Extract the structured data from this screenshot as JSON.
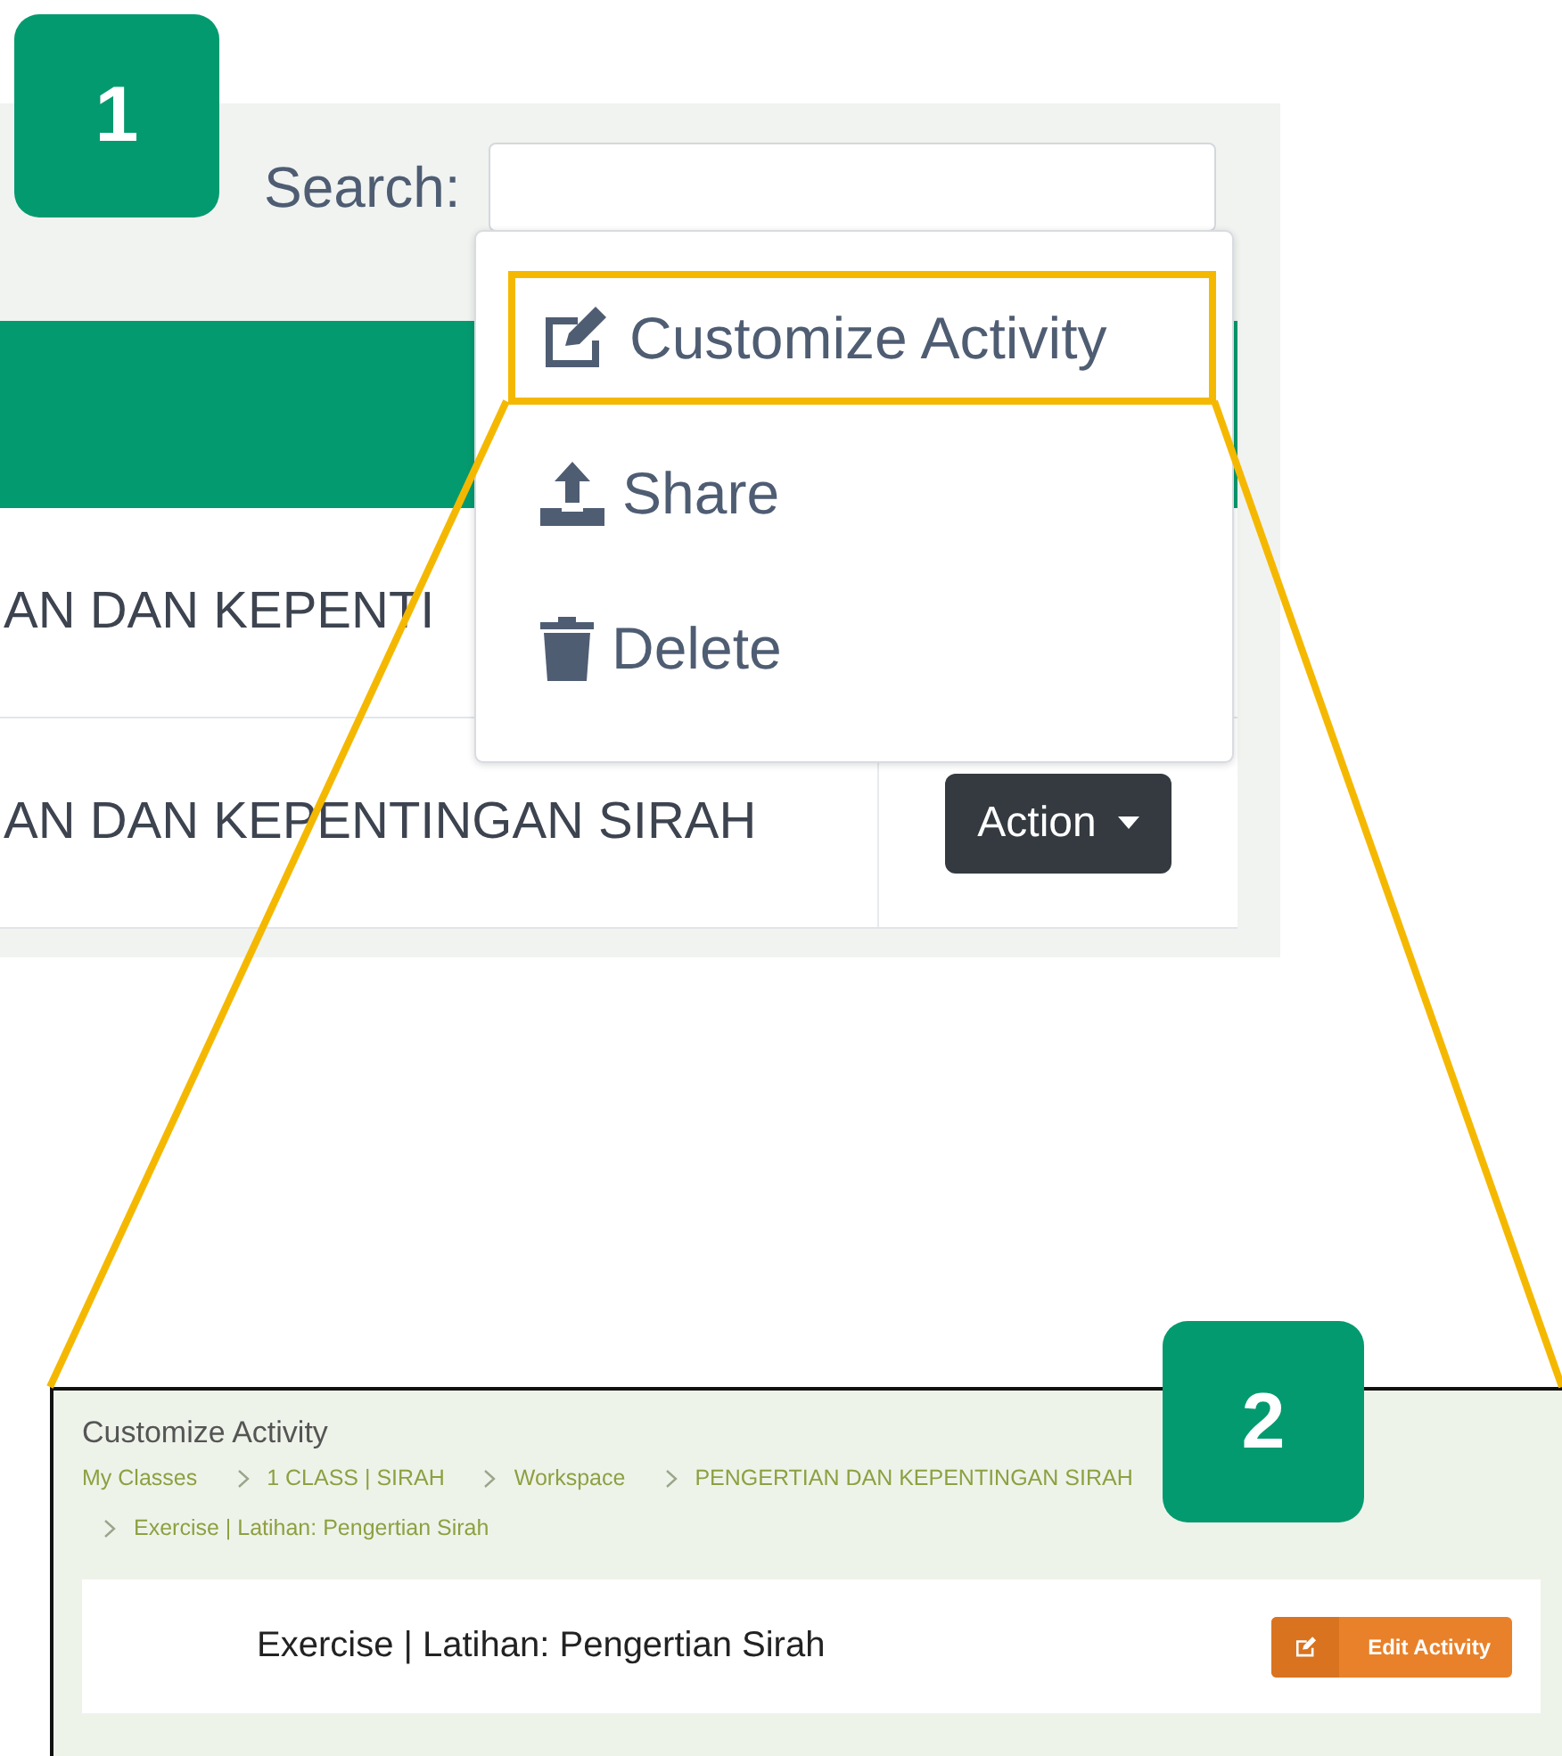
{
  "screen_1": {
    "badge": "1",
    "search": {
      "label": "Search:"
    },
    "table": {
      "rows": [
        {
          "column_1": "AN DAN KEPENTI"
        },
        {
          "column_1": "AN DAN KEPENTINGAN SIRAH",
          "action": "Action"
        }
      ]
    },
    "menu": {
      "items": [
        {
          "kind": "edit",
          "label": "Customize Activity",
          "highlighted": true
        },
        {
          "kind": "share",
          "label": "Share",
          "highlighted": false
        },
        {
          "kind": "delete",
          "label": "Delete",
          "highlighted": false
        }
      ]
    }
  },
  "screen_2": {
    "badge": "2",
    "title": "Customize Activity",
    "breadcrumbs": [
      "My Classes",
      "1 CLASS | SIRAH",
      "Workspace",
      "PENGERTIAN DAN KEPENTINGAN SIRAH",
      "Exercise | Latihan: Pengertian Sirah"
    ],
    "card": {
      "title": "Exercise | Latihan: Pengertian Sirah",
      "button": "Edit Activity"
    }
  }
}
